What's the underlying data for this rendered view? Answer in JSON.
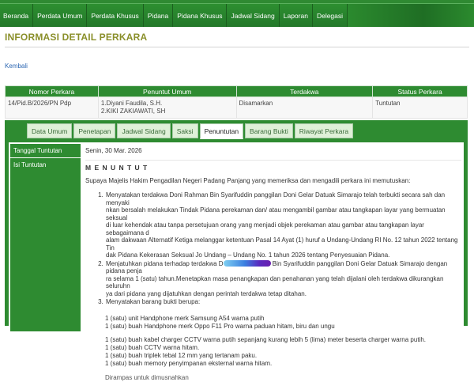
{
  "nav": {
    "items": [
      "Beranda",
      "Perdata Umum",
      "Perdata Khusus",
      "Pidana",
      "Pidana Khusus",
      "Jadwal Sidang",
      "Laporan",
      "Delegasi"
    ]
  },
  "page": {
    "title": "INFORMASI DETAIL PERKARA",
    "back_label": "Kembali"
  },
  "case_table": {
    "headers": [
      "Nomor Perkara",
      "Penuntut Umum",
      "Terdakwa",
      "Status Perkara"
    ],
    "row": {
      "nomor": "14/Pid.B/2026/PN Pdp",
      "penuntut_1": "1.Diyani Faudila, S.H.",
      "penuntut_2": "2.KIKI ZAKIAWATI, SH",
      "terdakwa": "Disamarkan",
      "status": "Tuntutan"
    }
  },
  "tabs": [
    "Data Umum",
    "Penetapan",
    "Jadwal Sidang",
    "Saksi",
    "Penuntutan",
    "Barang Bukti",
    "Riwayat Perkara"
  ],
  "active_tab": "Penuntutan",
  "tuntutan": {
    "date_label": "Tanggal Tuntutan",
    "date_value": "Senin, 30 Mar. 2026",
    "isi_label": "Isi Tuntutan",
    "heading": "M E N U N T U T",
    "intro": "Supaya Majelis Hakim Pengadilan Negeri Padang Panjang yang memeriksa dan mengadili perkara ini memutuskan:",
    "item1_lines": [
      "Menyatakan terdakwa Doni Rahman Bin Syarifuddin panggilan Doni Gelar Datuak Simarajo telah terbukti secara sah dan menyaki",
      "nkan bersalah melakukan Tindak Pidana perekaman dan/ atau mengambil gambar atau tangkapan layar yang bermuatan seksual",
      "di luar kehendak atau tanpa persetujuan orang yang menjadi objek perekaman atau gambar atau tangkapan layar sebagaimana d",
      "alam dakwaan Alternatif Ketiga melanggar ketentuan Pasal 14 Ayat (1) huruf a Undang-Undang RI No. 12 tahun 2022 tentang Tin",
      "dak Pidana Kekerasan Seksual Jo Undang – Undang No. 1 tahun 2026 tentang Penyesuaian Pidana."
    ],
    "item2_pre": "Menjatuhkan pidana terhadap terdakwa D",
    "item2_post": " Bin Syarifuddin panggilan Doni Gelar Datuak Simarajo dengan pidana penja",
    "item2_lines": [
      "ra selama 1 (satu) tahun.Menetapkan masa penangkapan dan penahanan yang telah dijalani oleh terdakwa dikurangkan seluruhn",
      "ya dari pidana yang dijatuhkan dengan perintah terdakwa tetap ditahan."
    ],
    "item3": "Menyatakan barang bukti berupa:",
    "evidence_group1": [
      "1 (satu) unit Handphone merk Samsung A54 warna putih",
      "1 (satu) buah Handphone merk Oppo F11 Pro warna paduan hitam, biru dan ungu"
    ],
    "evidence_group2": [
      "1 (satu) buah kabel charger CCTV warna putih sepanjang kurang lebih 5 (lima) meter beserta charger warna putih.",
      "1 (satu) buah CCTV warna hitam.",
      "1 (satu) buah triplek tebal 12 mm yang tertanam paku.",
      "1 (satu) buah memory penyimpanan eksternal warna hitam."
    ],
    "clipped_line": "Dirampas untuk dimusnahkan"
  },
  "colors": {
    "nav_green": "#2e8b31",
    "title_olive": "#8a8f2a",
    "link_blue": "#2b66b2",
    "redaction_gradient": [
      "#7fd0f2",
      "#3b7fe0",
      "#6a1fb0"
    ]
  }
}
